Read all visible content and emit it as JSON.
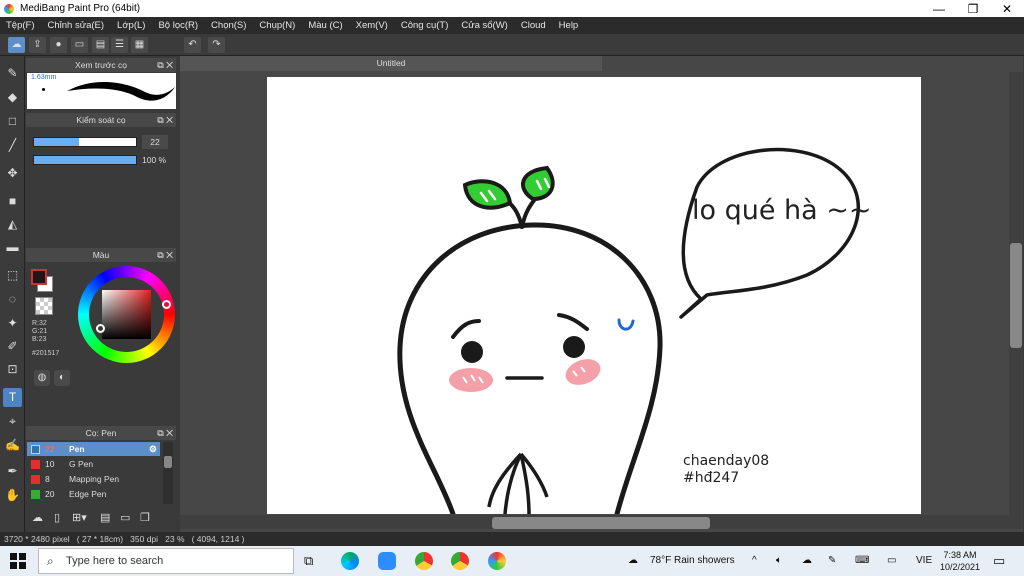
{
  "window": {
    "title": "MediBang Paint Pro (64bit)",
    "minimize": "—",
    "restore": "❐",
    "close": "✕"
  },
  "menu": [
    "Tệp(F)",
    "Chỉnh sửa(E)",
    "Lớp(L)",
    "Bộ lọc(R)",
    "Chọn(S)",
    "Chụp(N)",
    "Màu (C)",
    "Xem(V)",
    "Công cụ(T)",
    "Cửa sổ(W)",
    "Cloud",
    "Help"
  ],
  "toolbar": {
    "undo": "↶",
    "redo": "↷"
  },
  "panels": {
    "brush_preview": {
      "title": "Xem trước cọ",
      "size_label": "1.63mm"
    },
    "brush_control": {
      "title": "Kiểm soát cọ",
      "size_value": "22",
      "opacity_value": "100 %",
      "size_fraction": 0.44,
      "opacity_fraction": 1.0
    },
    "color": {
      "title": "Màu",
      "r": "R:32",
      "g": "G:21",
      "b": "B:23",
      "hex": "#201517",
      "primary": "#201517",
      "secondary": "#ffffff"
    },
    "brush_list": {
      "title": "Cọ: Pen",
      "items": [
        {
          "size": "22",
          "name": "Pen",
          "color": "#3a6fb0",
          "selected": true
        },
        {
          "size": "10",
          "name": "G Pen",
          "color": "#e03030",
          "selected": false
        },
        {
          "size": "8",
          "name": "Mapping Pen",
          "color": "#e03030",
          "selected": false
        },
        {
          "size": "20",
          "name": "Edge Pen",
          "color": "#30b030",
          "selected": false
        }
      ]
    }
  },
  "document": {
    "tab_title": "Untitled"
  },
  "canvas_text": {
    "speech": "lo qué hà ~~",
    "signature_line1": "chaenday08",
    "signature_line2": "#hđ247"
  },
  "status": {
    "text": "3720 * 2480 pixel   ( 27 * 18cm)   350 dpi   23 %   ( 4094, 1214 )"
  },
  "taskbar": {
    "search_placeholder": "Type here to search",
    "weather": "78°F  Rain showers",
    "lang": "VIE",
    "time": "7:38 AM",
    "date": "10/2/2021"
  },
  "colors": {
    "accent": "#5b8fc9",
    "leaf": "#33cc33",
    "blush": "#f4a0a8",
    "sweat": "#2266dd"
  }
}
